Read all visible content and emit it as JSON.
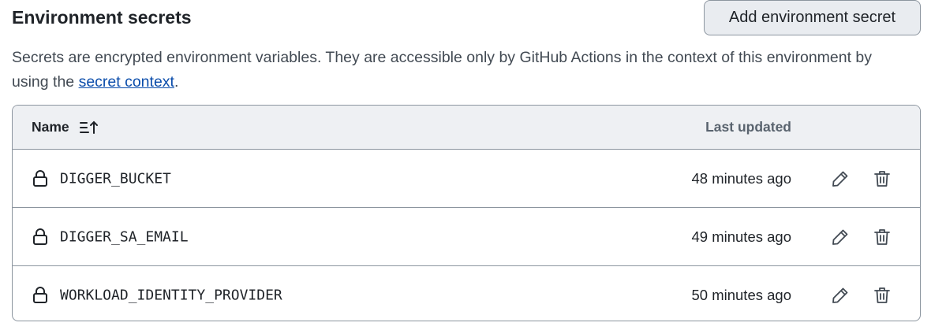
{
  "page": {
    "title": "Environment secrets",
    "add_button_label": "Add environment secret",
    "description_prefix": "Secrets are encrypted environment variables. They are accessible only by GitHub Actions in the context of this environment by using the ",
    "description_link": "secret context",
    "description_suffix": "."
  },
  "table": {
    "columns": {
      "name": "Name",
      "last_updated": "Last updated"
    },
    "sort_icon": "sort-ascending-icon",
    "rows": [
      {
        "name": "DIGGER_BUCKET",
        "updated": "48 minutes ago",
        "icon": "lock-icon"
      },
      {
        "name": "DIGGER_SA_EMAIL",
        "updated": "49 minutes ago",
        "icon": "lock-icon"
      },
      {
        "name": "WORKLOAD_IDENTITY_PROVIDER",
        "updated": "50 minutes ago",
        "icon": "lock-icon"
      }
    ],
    "row_actions": [
      "pencil-icon",
      "trash-icon"
    ]
  },
  "colors": {
    "link": "#0b4dab",
    "header_bg": "#eef0f3",
    "button_bg": "#e9ecf0",
    "border": "#8c959f"
  }
}
